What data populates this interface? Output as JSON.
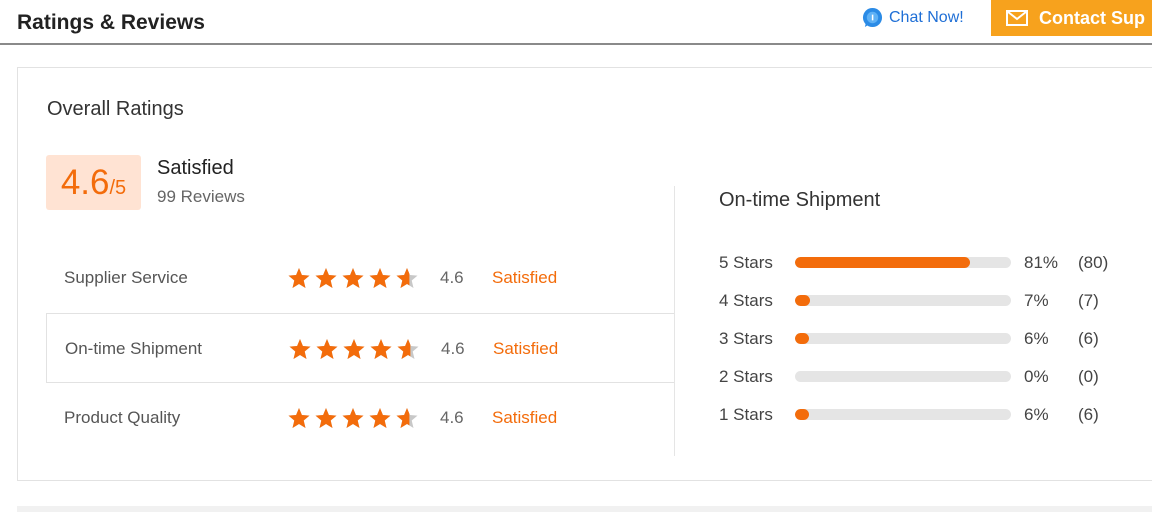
{
  "header": {
    "title": "Ratings & Reviews",
    "chat_label": "Chat Now!",
    "contact_label": "Contact Sup"
  },
  "overall": {
    "heading": "Overall Ratings",
    "score": "4.6",
    "score_max": "/5",
    "label": "Satisfied",
    "reviews": "99 Reviews"
  },
  "categories": [
    {
      "name": "Supplier Service",
      "rating": 4.6,
      "score_text": "4.6",
      "status": "Satisfied",
      "highlighted": false
    },
    {
      "name": "On-time Shipment",
      "rating": 4.6,
      "score_text": "4.6",
      "status": "Satisfied",
      "highlighted": true
    },
    {
      "name": "Product Quality",
      "rating": 4.6,
      "score_text": "4.6",
      "status": "Satisfied",
      "highlighted": false
    }
  ],
  "distribution": {
    "title": "On-time Shipment",
    "rows": [
      {
        "label": "5  Stars",
        "percent": 81,
        "percent_text": "81%",
        "count_text": "(80)"
      },
      {
        "label": "4  Stars",
        "percent": 7,
        "percent_text": "7%",
        "count_text": "(7)"
      },
      {
        "label": "3  Stars",
        "percent": 6,
        "percent_text": "6%",
        "count_text": "(6)"
      },
      {
        "label": "2  Stars",
        "percent": 0,
        "percent_text": "0%",
        "count_text": "(0)"
      },
      {
        "label": "1  Stars",
        "percent": 6,
        "percent_text": "6%",
        "count_text": "(6)"
      }
    ]
  },
  "colors": {
    "accent": "#f36c0b",
    "star_empty": "#c8c8c8",
    "contact_button": "#f7a21d",
    "chat_link": "#1f6fd6"
  },
  "icons": {
    "chat": "chat-bubble-icon",
    "contact": "mail-icon",
    "star": "star-icon"
  }
}
